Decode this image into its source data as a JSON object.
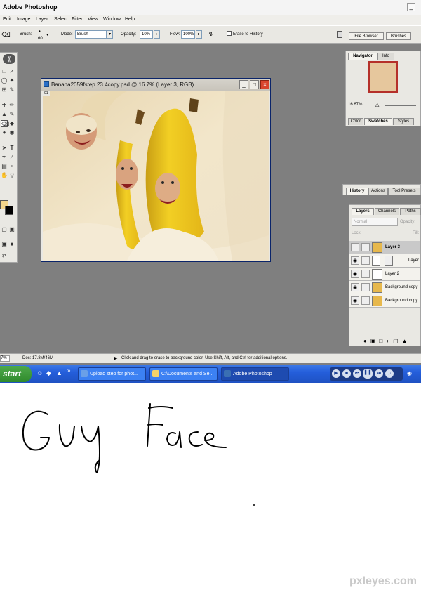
{
  "window": {
    "title": "Adobe Photoshop"
  },
  "menu": [
    "Edit",
    "Image",
    "Layer",
    "Select",
    "Filter",
    "View",
    "Window",
    "Help"
  ],
  "options": {
    "brush_label": "Brush:",
    "brush_size": "60",
    "mode_label": "Mode:",
    "mode_value": "Brush",
    "opacity_label": "Opacity:",
    "opacity_value": "10%",
    "flow_label": "Flow:",
    "flow_value": "100%",
    "erase_history": "Erase to History",
    "file_browser": "File Browser",
    "brushes": "Brushes"
  },
  "document": {
    "title": "Banana2059fstep  23 4copy.psd @ 16.7% (Layer 3, RGB)",
    "tag": "01"
  },
  "navigator": {
    "tabs": [
      "Navigator",
      "Info"
    ],
    "zoom": "16.67%"
  },
  "swatches": {
    "tabs": [
      "Color",
      "Swatches",
      "Styles"
    ]
  },
  "history": {
    "tabs": [
      "History",
      "Actions",
      "Tool Presets"
    ]
  },
  "layers": {
    "tabs": [
      "Layers",
      "Channels",
      "Paths"
    ],
    "blend_mode": "Normal",
    "opacity_label": "Opacity:",
    "lock_label": "Lock:",
    "fill_label": "Fill:",
    "rows": [
      {
        "name": "Layer 3"
      },
      {
        "name": "Layer"
      },
      {
        "name": "Layer 2"
      },
      {
        "name": "Background copy"
      },
      {
        "name": "Background copy"
      }
    ]
  },
  "status": {
    "zoom": "7%",
    "doc": "Doc: 17.8M/46M",
    "hint": "Click and drag to erase to background color. Use Shift, Alt, and Ctrl for additional options."
  },
  "taskbar": {
    "start": "start",
    "tasks": [
      "Upload step for phot...",
      "C:\\Documents and Se...",
      "Adobe Photoshop"
    ]
  },
  "watermark": "pxleyes.com",
  "colors": {
    "desktop_gray": "#7f7f7f",
    "xp_blue": "#245edb",
    "start_green": "#3a9a37"
  }
}
